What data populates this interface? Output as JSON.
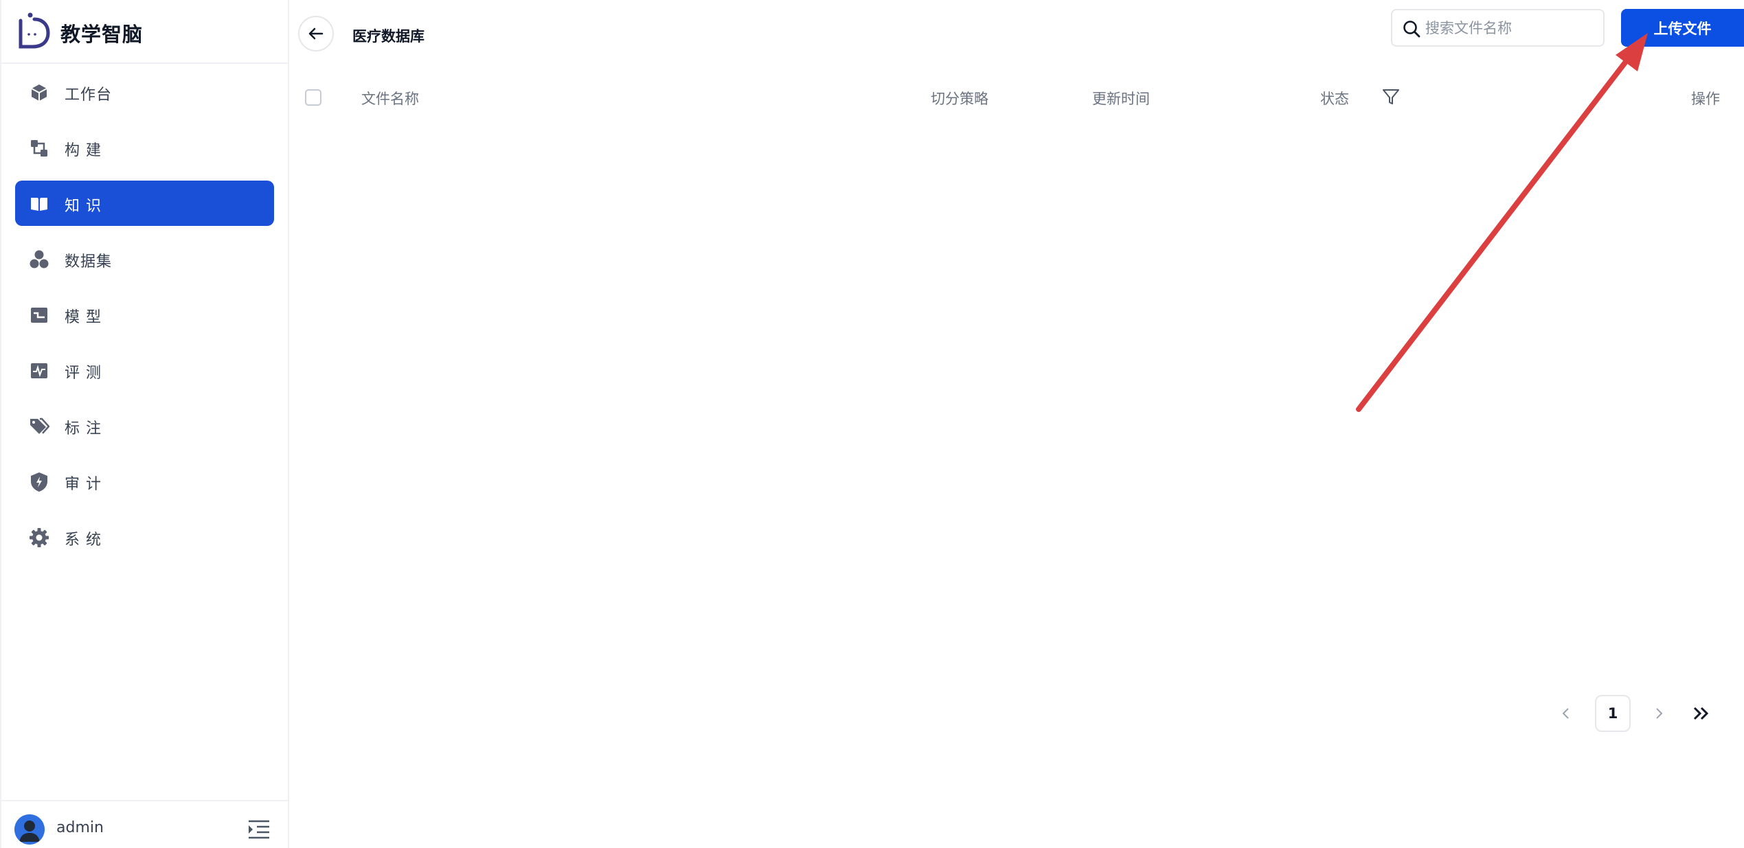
{
  "brand": {
    "name": "教学智脑"
  },
  "sidebar": {
    "items": [
      {
        "label": "工作台",
        "icon": "cube-icon",
        "active": false
      },
      {
        "label": "构  建",
        "icon": "build-icon",
        "active": false
      },
      {
        "label": "知  识",
        "icon": "book-icon",
        "active": true
      },
      {
        "label": "数据集",
        "icon": "hexagons-icon",
        "active": false
      },
      {
        "label": "模  型",
        "icon": "model-icon",
        "active": false
      },
      {
        "label": "评  测",
        "icon": "pulse-icon",
        "active": false
      },
      {
        "label": "标  注",
        "icon": "tags-icon",
        "active": false
      },
      {
        "label": "审  计",
        "icon": "shield-bolt-icon",
        "active": false
      },
      {
        "label": "系  统",
        "icon": "gear-icon",
        "active": false
      }
    ],
    "user": {
      "name": "admin"
    }
  },
  "header": {
    "title": "医疗数据库",
    "search_placeholder": "搜索文件名称",
    "upload_label": "上传文件"
  },
  "table": {
    "columns": {
      "name": "文件名称",
      "strategy": "切分策略",
      "updated": "更新时间",
      "status": "状态",
      "actions": "操作"
    },
    "rows": []
  },
  "pagination": {
    "current_page": "1"
  },
  "colors": {
    "primary": "#1a4fd8",
    "upload_button": "#0b4fe3",
    "annotation_arrow": "#dc3f3f"
  }
}
